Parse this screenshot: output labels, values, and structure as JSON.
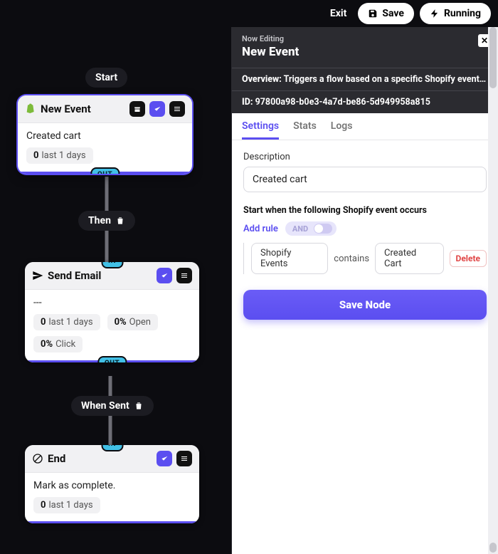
{
  "topbar": {
    "exit": "Exit",
    "save": "Save",
    "running": "Running"
  },
  "pills": {
    "start": "Start",
    "then": "Then",
    "when_sent": "When Sent"
  },
  "ports": {
    "out": "Out",
    "in": "In"
  },
  "node_new_event": {
    "title": "New Event",
    "body": "Created cart",
    "metric_value": "0",
    "metric_label": "last 1 days"
  },
  "node_send_email": {
    "title": "Send Email",
    "body": "---",
    "m1_value": "0",
    "m1_label": "last 1 days",
    "m2_value": "0%",
    "m2_label": "Open",
    "m3_value": "0%",
    "m3_label": "Click"
  },
  "node_end": {
    "title": "End",
    "body": "Mark as complete.",
    "metric_value": "0",
    "metric_label": "last 1 days"
  },
  "panel": {
    "now_editing": "Now Editing",
    "title": "New Event",
    "overview_label": "Overview:",
    "overview_text": "Triggers a flow based on a specific Shopify event or...",
    "id_label": "ID:",
    "id_value": "97800a98-b0e3-4a7d-be86-5d949958a815",
    "tabs": {
      "settings": "Settings",
      "stats": "Stats",
      "logs": "Logs"
    },
    "description_label": "Description",
    "description_value": "Created cart",
    "rule_section_label": "Start when the following Shopify event occurs",
    "add_rule": "Add rule",
    "andor": "AND",
    "rule_field": "Shopify Events",
    "rule_op": "contains",
    "rule_value": "Created Cart",
    "delete": "Delete",
    "save_node": "Save Node"
  }
}
